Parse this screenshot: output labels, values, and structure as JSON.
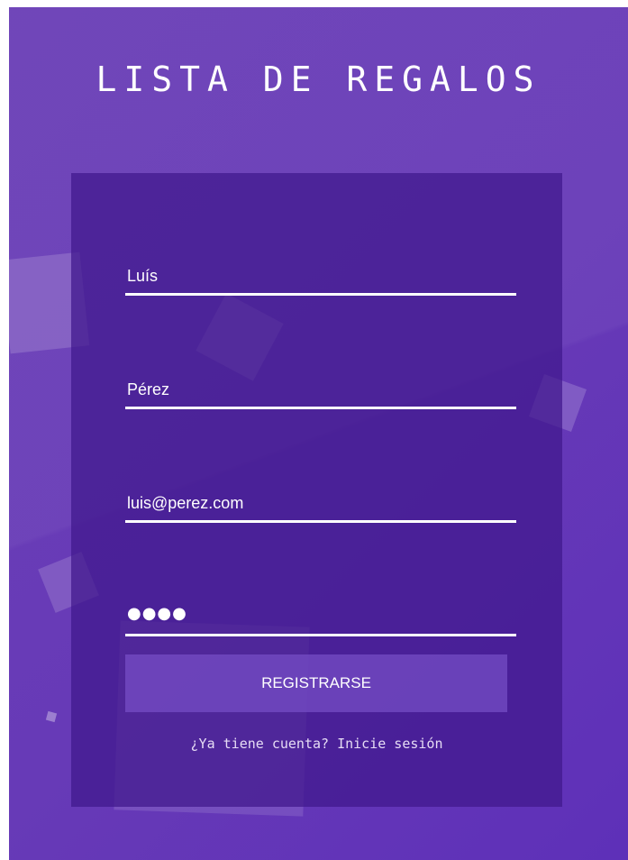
{
  "page": {
    "title": "LISTA DE REGALOS"
  },
  "form": {
    "first_name": {
      "value": "Luís"
    },
    "last_name": {
      "value": "Pérez"
    },
    "email": {
      "value": "luis@perez.com"
    },
    "password": {
      "masked": "●●●●"
    },
    "submit_label": "REGISTRARSE",
    "login_link": "¿Ya tiene cuenta? Inicie sesión"
  },
  "colors": {
    "background": "#673ab7",
    "card": "#4a1f96",
    "button": "#7a52c8",
    "text": "#ffffff"
  }
}
